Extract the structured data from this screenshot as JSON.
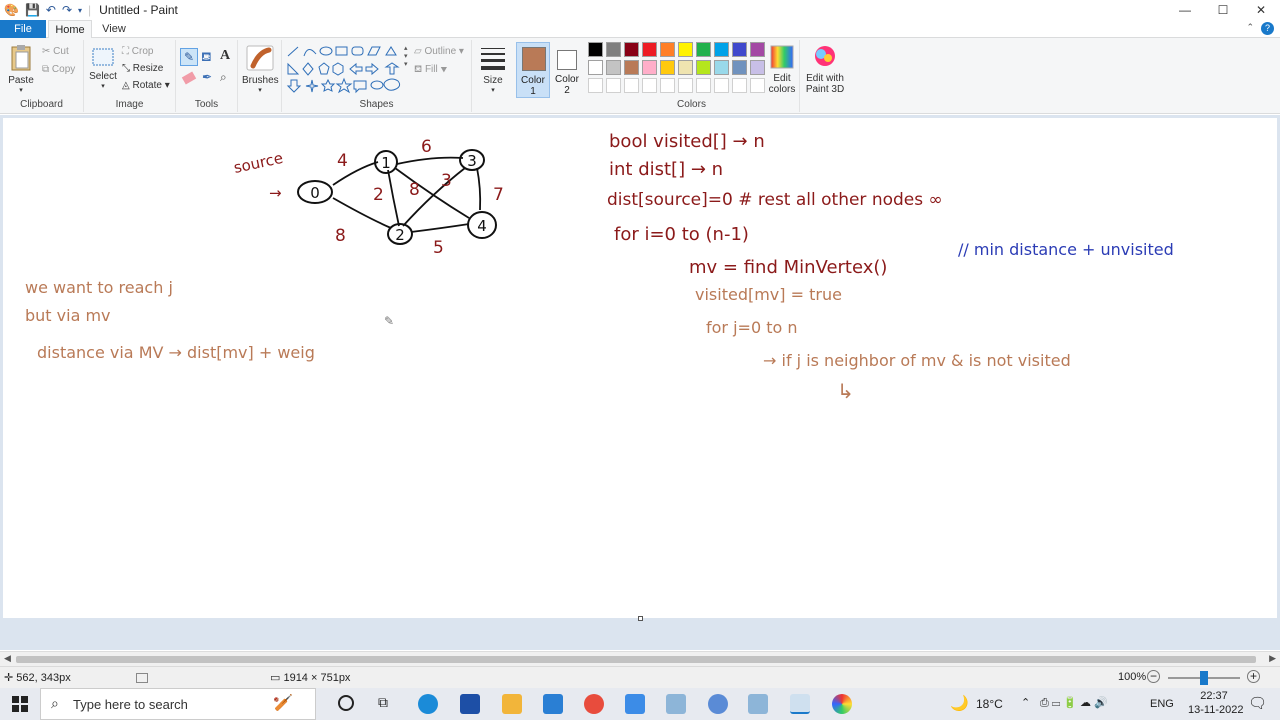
{
  "window": {
    "title": "Untitled - Paint",
    "minimize": "—",
    "maximize": "☐",
    "close": "✕"
  },
  "tabs": {
    "file": "File",
    "home": "Home",
    "view": "View"
  },
  "ribbon": {
    "clipboard": {
      "paste": "Paste",
      "cut": "Cut",
      "copy": "Copy",
      "label": "Clipboard"
    },
    "image": {
      "select": "Select",
      "crop": "Crop",
      "resize": "Resize",
      "rotate": "Rotate",
      "label": "Image"
    },
    "tools": {
      "label": "Tools"
    },
    "brushes": {
      "label": "Brushes"
    },
    "shapes": {
      "outline": "Outline",
      "fill": "Fill",
      "label": "Shapes"
    },
    "size": {
      "label": "Size"
    },
    "color1": {
      "label": "Color 1",
      "value": "#b97a57"
    },
    "color2": {
      "label": "Color 2",
      "value": "#ffffff"
    },
    "colors": {
      "label": "Colors",
      "row1": [
        "#000000",
        "#7f7f7f",
        "#880015",
        "#ed1c24",
        "#ff7f27",
        "#fff200",
        "#22b14c",
        "#00a2e8",
        "#3f48cc",
        "#a349a4"
      ],
      "row2": [
        "#ffffff",
        "#c3c3c3",
        "#b97a57",
        "#ffaec9",
        "#ffc90e",
        "#efe4b0",
        "#b5e61d",
        "#99d9ea",
        "#7092be",
        "#c8bfe7"
      ]
    },
    "edit_colors": "Edit colors",
    "paint3d": "Edit with Paint 3D"
  },
  "drawing": {
    "graph": {
      "source_label": "source",
      "nodes": [
        "0",
        "1",
        "2",
        "3",
        "4"
      ],
      "weights": [
        "4",
        "6",
        "2",
        "8",
        "3",
        "7",
        "8",
        "5"
      ]
    },
    "left_notes": [
      "we want to reach j",
      "but via mv",
      "distance via MV → dist[mv] + weig"
    ],
    "right_notes": [
      "bool visited[] → n",
      "int dist[] → n",
      "dist[source]=0 # rest all other nodes ∞",
      "for i=0 to (n-1)",
      "mv = find MinVertex()",
      "// min distance + unvisited",
      "visited[mv] = true",
      "for j=0 to n",
      "→ if j is neighbor of mv & is not visited",
      "↳"
    ],
    "colors": {
      "maroon": "#8b1a1a",
      "brown": "#b97a57",
      "blue": "#2b3cb5",
      "black": "#111111"
    }
  },
  "status": {
    "cursor_pos": "562, 343px",
    "canvas_size": "1914 × 751px",
    "zoom": "100%"
  },
  "taskbar": {
    "search_placeholder": "Type here to search",
    "weather": "18°C",
    "lang": "ENG",
    "time": "22:37",
    "date": "13-11-2022"
  }
}
